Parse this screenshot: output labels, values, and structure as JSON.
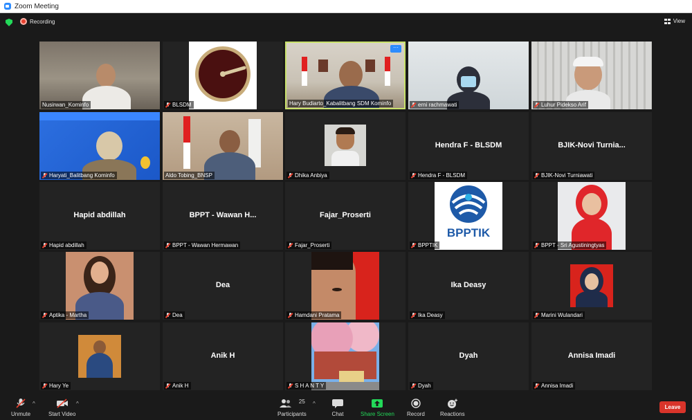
{
  "window": {
    "title": "Zoom Meeting"
  },
  "topbar": {
    "recording_label": "Recording",
    "view_label": "View"
  },
  "tiles": [
    {
      "name": "Nusirwan_Kominfo",
      "display": ""
    },
    {
      "name": "BLSDM",
      "display": ""
    },
    {
      "name": "Hary Budiarto_Kabalitbang SDM Kominfo",
      "display": ""
    },
    {
      "name": "erni rachmawati",
      "display": ""
    },
    {
      "name": "Luhur Pidekso Arif",
      "display": ""
    },
    {
      "name": "Haryati_Balitbang Kominfo",
      "display": ""
    },
    {
      "name": "Aldo Tobing_BNSP",
      "display": ""
    },
    {
      "name": "Dhika Anbiya",
      "display": ""
    },
    {
      "name": "Hendra F - BLSDM",
      "display": "Hendra F - BLSDM"
    },
    {
      "name": "BJIK-Novi Turniawati",
      "display": "BJIK-Novi  Turnia..."
    },
    {
      "name": "Hapid abdillah",
      "display": "Hapid abdillah"
    },
    {
      "name": "BPPT - Wawan Hermawan",
      "display": "BPPT - Wawan H..."
    },
    {
      "name": "Fajar_Proserti",
      "display": "Fajar_Proserti"
    },
    {
      "name": "BPPTIK",
      "display": ""
    },
    {
      "name": "BPPT - Sri Agustiningtyas",
      "display": ""
    },
    {
      "name": "Aptika - Martha",
      "display": ""
    },
    {
      "name": "Dea",
      "display": "Dea"
    },
    {
      "name": "Hamdani Pratama",
      "display": ""
    },
    {
      "name": "Ika Deasy",
      "display": "Ika Deasy"
    },
    {
      "name": "Marini Wulandari",
      "display": ""
    },
    {
      "name": "Hary Ye",
      "display": ""
    },
    {
      "name": "Anik H",
      "display": "Anik H"
    },
    {
      "name": "S H A N T Y",
      "display": ""
    },
    {
      "name": "Dyah",
      "display": "Dyah"
    },
    {
      "name": "Annisa Imadi",
      "display": "Annisa Imadi"
    }
  ],
  "logo_text": {
    "bpptik": "BPPTIK"
  },
  "toolbar": {
    "unmute": "Unmute",
    "start_video": "Start Video",
    "participants": "Participants",
    "participants_count": "25",
    "chat": "Chat",
    "share_screen": "Share Screen",
    "record": "Record",
    "reactions": "Reactions",
    "leave": "Leave"
  },
  "colors": {
    "accent_green": "#23d959",
    "leave_red": "#d9342a",
    "active_speaker": "#c9e26b",
    "zoom_blue": "#2d8cff"
  }
}
